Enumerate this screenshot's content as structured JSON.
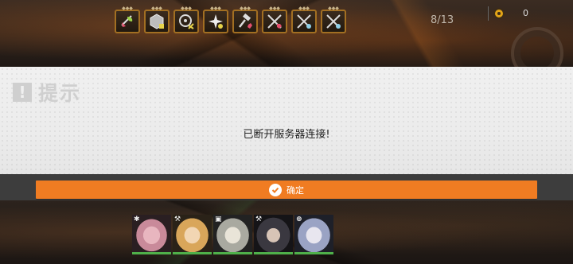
{
  "hud": {
    "skills": [
      {
        "name": "skill-1",
        "glyph": "leaf",
        "color": "#e44f6d"
      },
      {
        "name": "skill-2",
        "glyph": "hexagon",
        "color": "#bdbdbd"
      },
      {
        "name": "skill-3",
        "glyph": "target",
        "color": "#e6d34a"
      },
      {
        "name": "skill-4",
        "glyph": "star",
        "color": "#e6d34a"
      },
      {
        "name": "skill-5",
        "glyph": "hammer",
        "color": "#e44f6d"
      },
      {
        "name": "skill-6",
        "glyph": "crossed-swords",
        "color": "#e44f6d"
      },
      {
        "name": "skill-7",
        "glyph": "crossed-swords",
        "color": "#8fd0e8"
      },
      {
        "name": "skill-8",
        "glyph": "crossed-swords",
        "color": "#8fd0e8"
      }
    ],
    "counter": "8/13",
    "currency_value": "0"
  },
  "dialog": {
    "title": "提示",
    "message": "已断开服务器连接!",
    "confirm_label": "确定"
  },
  "team": [
    {
      "name": "member-1",
      "role_icon": "✱",
      "tint": "#c98a9a"
    },
    {
      "name": "member-2",
      "role_icon": "⚒",
      "tint": "#d9a65a"
    },
    {
      "name": "member-3",
      "role_icon": "▣",
      "tint": "#a9a9a0"
    },
    {
      "name": "member-4",
      "role_icon": "⚒",
      "tint": "#3a3840"
    },
    {
      "name": "member-5",
      "role_icon": "⊕",
      "tint": "#9aa3c4"
    }
  ],
  "colors": {
    "accent": "#f07c22",
    "dialog_bg": "#ececec",
    "footer_bg": "#3d3d3d",
    "skill_border": "#a26f22"
  }
}
